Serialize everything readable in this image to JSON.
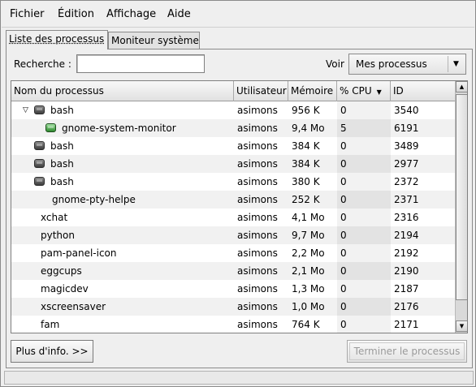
{
  "menu": {
    "file": "Fichier",
    "edit": "Édition",
    "view": "Affichage",
    "help": "Aide"
  },
  "tabs": {
    "process_list": "Liste des processus",
    "system_monitor": "Moniteur système"
  },
  "search": {
    "label": "Recherche  :",
    "value": ""
  },
  "view_filter": {
    "label": "Voir",
    "selected": "Mes processus"
  },
  "table": {
    "columns": {
      "name": "Nom du processus",
      "user": "Utilisateur",
      "memory": "Mémoire",
      "cpu": "% CPU",
      "id": "ID"
    },
    "rows": [
      {
        "name": "bash",
        "user": "asimons",
        "memory": "956 K",
        "cpu": "0",
        "id": "3540"
      },
      {
        "name": "gnome-system-monitor",
        "user": "asimons",
        "memory": "9,4 Mo",
        "cpu": "5",
        "id": "6191"
      },
      {
        "name": "bash",
        "user": "asimons",
        "memory": "384 K",
        "cpu": "0",
        "id": "3489"
      },
      {
        "name": "bash",
        "user": "asimons",
        "memory": "384 K",
        "cpu": "0",
        "id": "2977"
      },
      {
        "name": "bash",
        "user": "asimons",
        "memory": "380 K",
        "cpu": "0",
        "id": "2372"
      },
      {
        "name": "gnome-pty-helpe",
        "user": "asimons",
        "memory": "252 K",
        "cpu": "0",
        "id": "2371"
      },
      {
        "name": "xchat",
        "user": "asimons",
        "memory": "4,1 Mo",
        "cpu": "0",
        "id": "2316"
      },
      {
        "name": "python",
        "user": "asimons",
        "memory": "9,7 Mo",
        "cpu": "0",
        "id": "2194"
      },
      {
        "name": "pam-panel-icon",
        "user": "asimons",
        "memory": "2,2 Mo",
        "cpu": "0",
        "id": "2192"
      },
      {
        "name": "eggcups",
        "user": "asimons",
        "memory": "2,1 Mo",
        "cpu": "0",
        "id": "2190"
      },
      {
        "name": "magicdev",
        "user": "asimons",
        "memory": "1,3 Mo",
        "cpu": "0",
        "id": "2187"
      },
      {
        "name": "xscreensaver",
        "user": "asimons",
        "memory": "1,0 Mo",
        "cpu": "0",
        "id": "2176"
      },
      {
        "name": "fam",
        "user": "asimons",
        "memory": "764 K",
        "cpu": "0",
        "id": "2171"
      }
    ]
  },
  "buttons": {
    "more_info": "Plus d'info. >>",
    "end_process": "Terminer le processus"
  },
  "icons": {
    "expander": "triangle-down-icon",
    "process": "terminal-process-icon",
    "sort": "sort-descending-icon"
  }
}
